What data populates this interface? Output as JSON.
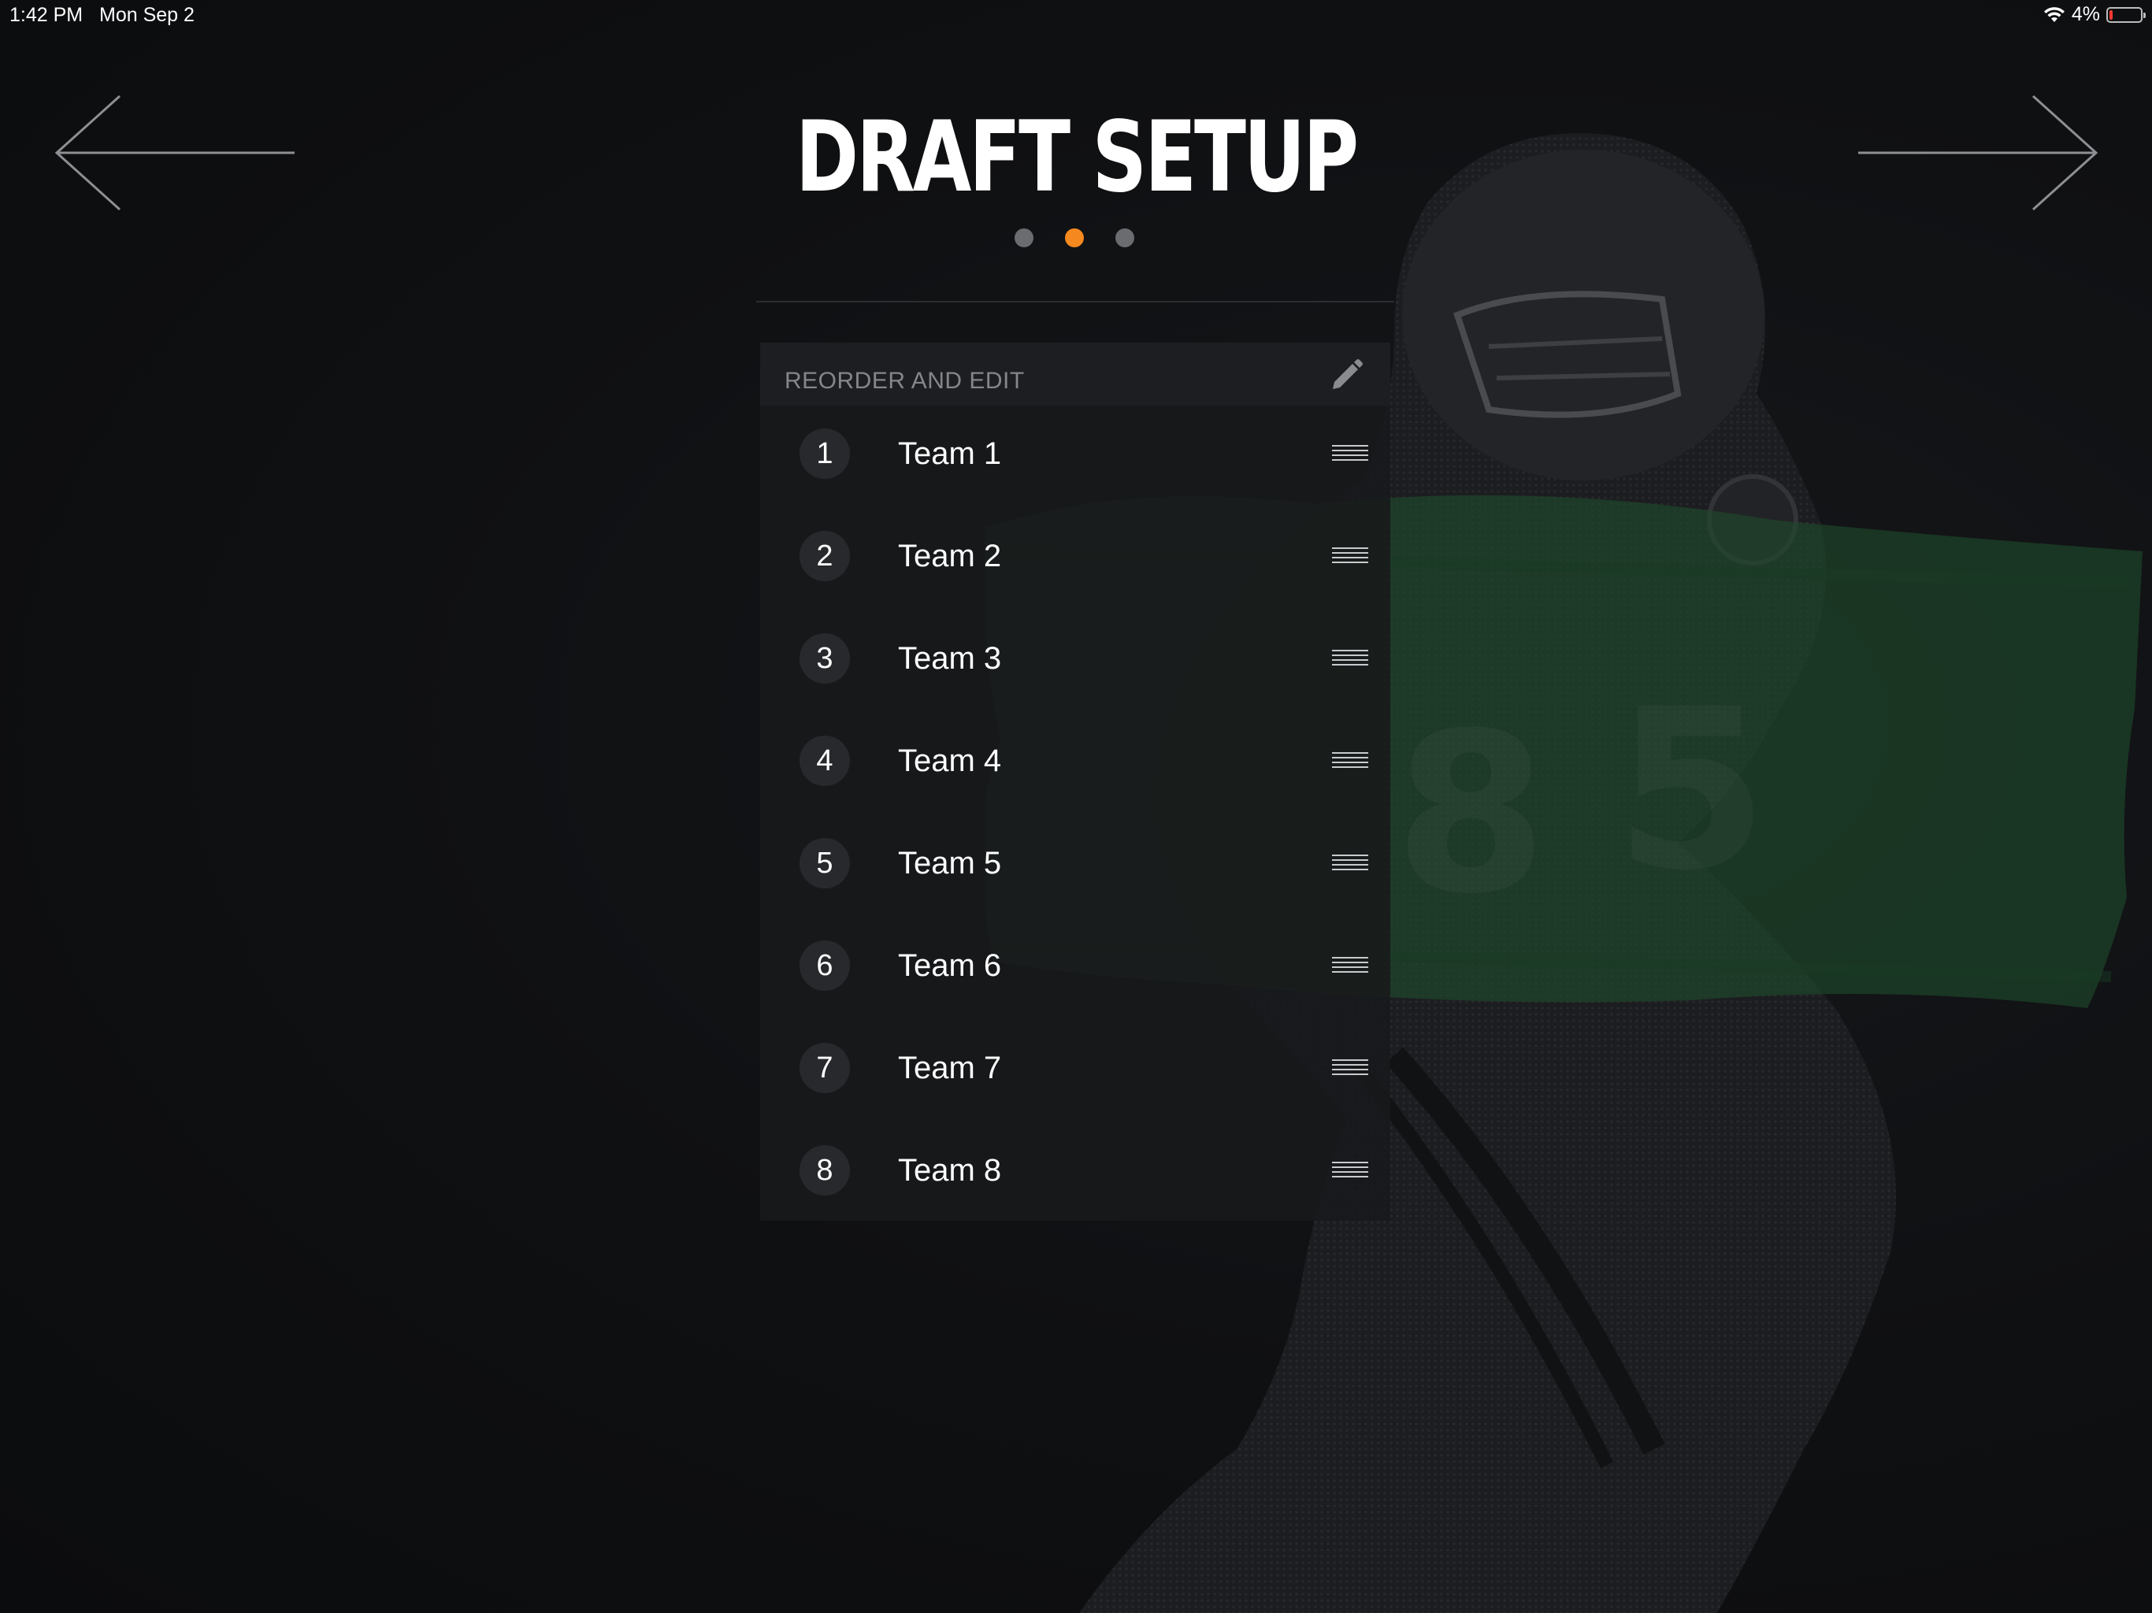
{
  "status_bar": {
    "time": "1:42 PM",
    "date": "Mon Sep 2",
    "battery": "4%",
    "wifi_icon": "wifi-icon",
    "battery_icon": "battery-icon",
    "battery_level": 0.04
  },
  "header": {
    "title": "DRAFT SETUP",
    "back_icon": "arrow-left-icon",
    "forward_icon": "arrow-right-icon",
    "current_step": 2,
    "total_steps": 3
  },
  "panel": {
    "header_label": "REORDER AND EDIT",
    "edit_icon": "pencil-icon",
    "drag_icon": "drag-handle-icon",
    "teams": [
      {
        "number": "1",
        "name": "Team 1"
      },
      {
        "number": "2",
        "name": "Team 2"
      },
      {
        "number": "3",
        "name": "Team 3"
      },
      {
        "number": "4",
        "name": "Team 4"
      },
      {
        "number": "5",
        "name": "Team 5"
      },
      {
        "number": "6",
        "name": "Team 6"
      },
      {
        "number": "7",
        "name": "Team 7"
      },
      {
        "number": "8",
        "name": "Team 8"
      }
    ]
  },
  "colors": {
    "accent": "#f5891f",
    "background": "#0d0e10",
    "panel": "#18191b",
    "brush_green": "#1f4a2c"
  }
}
